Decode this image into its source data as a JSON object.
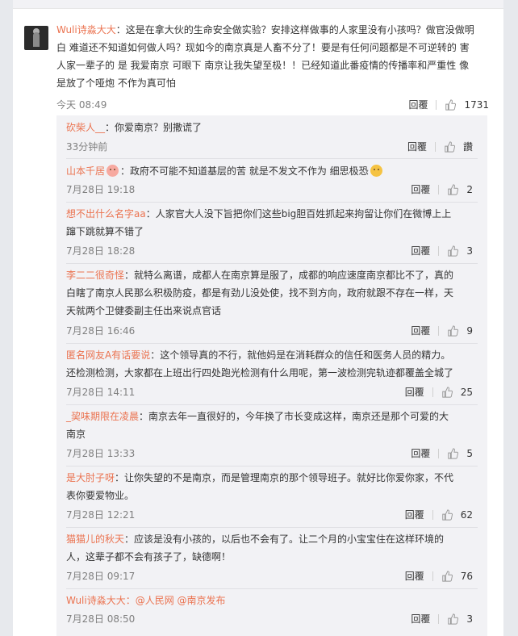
{
  "main": {
    "username": "Wuli诗淼大大",
    "text": "：这是在拿大伙的生命安全做实验？安排这样做事的人家里没有小孩吗？做官没做明白  难道还不知道如何做人吗？现如今的南京真是人畜不分了！要是有任何问题都是不可逆转的  害人家一辈子的  是  我爱南京  可眼下  南京让我失望至极！！已经知道此番疫情的传播率和严重性  像是放了个哑炮  不作为真可怕",
    "time": "今天 08:49",
    "reply_label": "回覆",
    "likes": "1731"
  },
  "replies": [
    {
      "username": "砍柴人__",
      "text": "：你爱南京？别撒谎了",
      "time": "33分钟前",
      "reply_label": "回覆",
      "likes": "讚"
    },
    {
      "username": "山本千居",
      "text": "：政府不可能不知道基层的苦 就是不发文不作为  细思极恐",
      "time": "7月28日 19:18",
      "reply_label": "回覆",
      "likes": "2"
    },
    {
      "username": "想不出什么名字aa",
      "text": "：人家官大人没下旨把你们这些big胆百姓抓起来拘留让你们在微博上上蹿下跳就算不错了",
      "time": "7月28日 18:28",
      "reply_label": "回覆",
      "likes": "3"
    },
    {
      "username": "李二二很奇怪",
      "text": "：就特么离谱，成都人在南京算是服了，成都的响应速度南京都比不了，真的白瞎了南京人民那么积极防疫，都是有劲儿没处使，找不到方向，政府就跟不存在一样，天天就两个卫健委副主任出来说点官话",
      "time": "7月28日 16:46",
      "reply_label": "回覆",
      "likes": "9"
    },
    {
      "username": "匿名网友A有话要说",
      "text": "：这个领导真的不行，就他妈是在消耗群众的信任和医务人员的精力。还检测检测，大家都在上班出行四处跑光检测有什么用呢，第一波检测完轨迹都覆盖全城了",
      "time": "7月28日 14:11",
      "reply_label": "回覆",
      "likes": "25"
    },
    {
      "username": "_巭味期限在凌晨",
      "text": "：南京去年一直很好的，今年换了市长变成这样，南京还是那个可爱的大南京",
      "time": "7月28日 13:33",
      "reply_label": "回覆",
      "likes": "5"
    },
    {
      "username": "是大肘子呀",
      "text": "：让你失望的不是南京，而是管理南京的那个领导班子。就好比你爱你家，不代表你要爱物业。",
      "time": "7月28日 12:21",
      "reply_label": "回覆",
      "likes": "62"
    },
    {
      "username": "猫猫儿的秋天",
      "text": "：应该是没有小孩的，以后也不会有了。让二个月的小宝宝住在这样环境的人，这辈子都不会有孩子了，缺德啊！",
      "time": "7月28日 09:17",
      "reply_label": "回覆",
      "likes": "76"
    },
    {
      "username": "Wuli诗淼大大",
      "text": "：@人民网 @南京发布",
      "time": "7月28日 08:50",
      "reply_label": "回覆",
      "likes": "3"
    }
  ],
  "colors": {
    "username": "#eb7350",
    "reply_bg": "#f2f2f5",
    "meta": "#808080"
  }
}
